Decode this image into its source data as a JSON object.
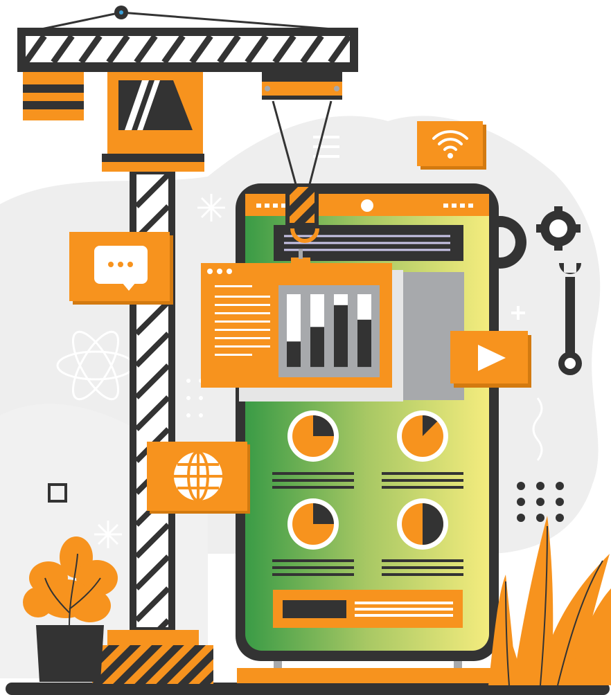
{
  "colors": {
    "orange": "#F7931E",
    "dark": "#333333",
    "blob": "#EEEEEE",
    "white": "#FFFFFF",
    "gray": "#A7A9AC",
    "green": "#3A9B46",
    "yellow": "#F4EC7E"
  },
  "icons": [
    "tower-crane-icon",
    "smartphone-icon",
    "chat-bubble-icon",
    "globe-icon",
    "wifi-icon",
    "play-button-icon",
    "gear-icon",
    "wrench-icon",
    "atom-icon",
    "pie-chart-icon",
    "bar-chart-icon",
    "potted-plant-icon",
    "grass-icon"
  ],
  "pie_charts": [
    {
      "fill_fraction": 0.25
    },
    {
      "fill_fraction": 0.125
    },
    {
      "fill_fraction": 0.25
    },
    {
      "fill_fraction": 0.5
    }
  ],
  "bar_chart": {
    "levels": [
      0.35,
      0.55,
      0.85,
      0.65
    ]
  }
}
